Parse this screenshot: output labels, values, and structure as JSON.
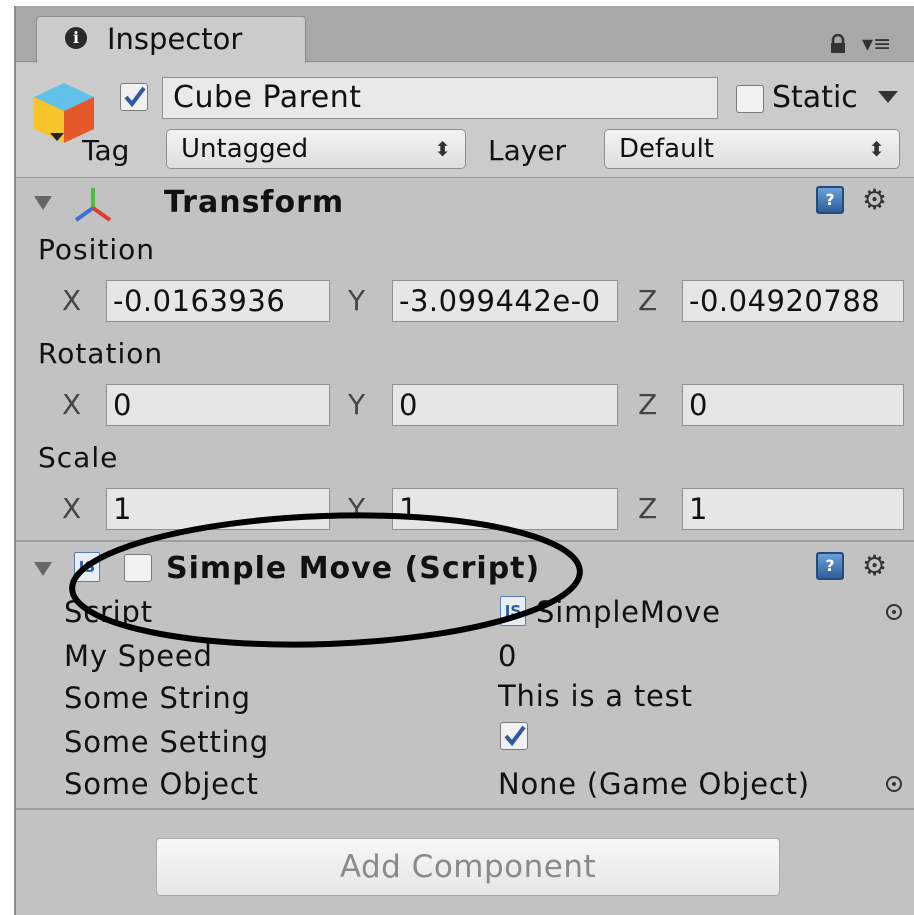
{
  "tab": {
    "title": "Inspector"
  },
  "header": {
    "active_checked": true,
    "object_name": "Cube Parent",
    "static_label": "Static",
    "tag_label": "Tag",
    "tag_value": "Untagged",
    "layer_label": "Layer",
    "layer_value": "Default"
  },
  "transform": {
    "title": "Transform",
    "position": {
      "label": "Position",
      "x": "-0.0163936",
      "y": "-3.099442e-0",
      "z": "-0.04920788"
    },
    "rotation": {
      "label": "Rotation",
      "x": "0",
      "y": "0",
      "z": "0"
    },
    "scale": {
      "label": "Scale",
      "x": "1",
      "y": "1",
      "z": "1"
    },
    "axes": {
      "x": "X",
      "y": "Y",
      "z": "Z"
    }
  },
  "script_component": {
    "title": "Simple Move (Script)",
    "icon_text": "JS",
    "enabled": false,
    "props": [
      {
        "label": "Script",
        "value": "SimpleMove"
      },
      {
        "label": "My Speed",
        "value": "0"
      },
      {
        "label": "Some String",
        "value": "This is a test"
      },
      {
        "label": "Some Setting",
        "value": ""
      },
      {
        "label": "Some Object",
        "value": "None (Game Object)"
      }
    ]
  },
  "add_component": {
    "label": "Add Component"
  },
  "colors": {
    "accent": "#2e5f9c",
    "panel": "#c2c2c2",
    "annotation": "#000000"
  }
}
